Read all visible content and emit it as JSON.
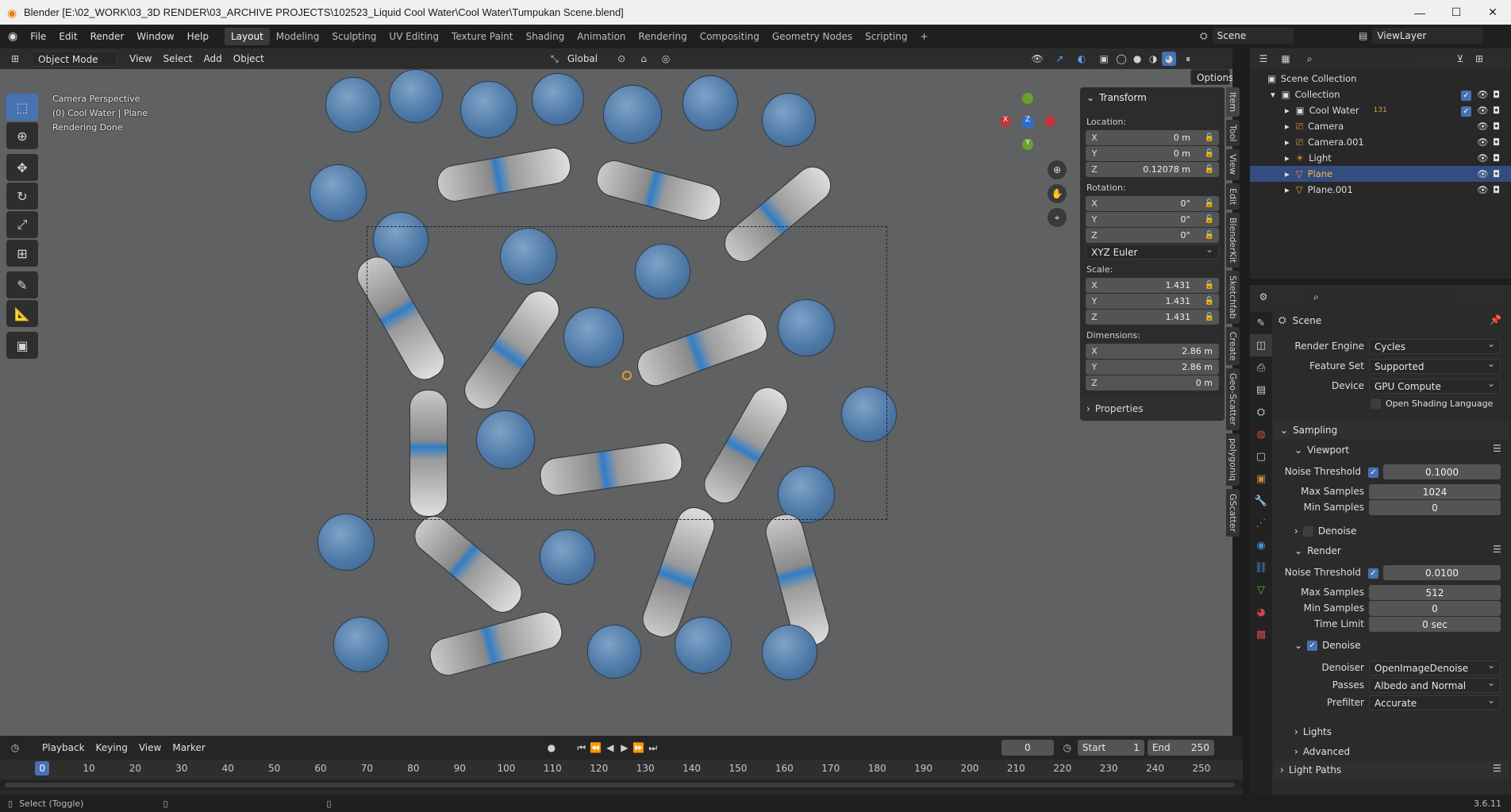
{
  "window": {
    "title": "Blender [E:\\02_WORK\\03_3D RENDER\\03_ARCHIVE PROJECTS\\102523_Liquid Cool Water\\Cool Water\\Tumpukan Scene.blend]"
  },
  "menu": [
    "File",
    "Edit",
    "Render",
    "Window",
    "Help"
  ],
  "workspaces": [
    "Layout",
    "Modeling",
    "Sculpting",
    "UV Editing",
    "Texture Paint",
    "Shading",
    "Animation",
    "Rendering",
    "Compositing",
    "Geometry Nodes",
    "Scripting"
  ],
  "active_workspace": "Layout",
  "scene_name": "Scene",
  "view_layer": "ViewLayer",
  "viewport_header": {
    "mode": "Object Mode",
    "items": [
      "View",
      "Select",
      "Add",
      "Object"
    ],
    "orientation": "Global",
    "options": "Options"
  },
  "viewport_overlay": {
    "line1": "Camera Perspective",
    "line2": "(0) Cool Water | Plane",
    "line3": "Rendering Done"
  },
  "npanel": {
    "header": "Transform",
    "location_label": "Location:",
    "location": [
      {
        "axis": "X",
        "value": "0 m"
      },
      {
        "axis": "Y",
        "value": "0 m"
      },
      {
        "axis": "Z",
        "value": "0.12078 m"
      }
    ],
    "rotation_label": "Rotation:",
    "rotation": [
      {
        "axis": "X",
        "value": "0°"
      },
      {
        "axis": "Y",
        "value": "0°"
      },
      {
        "axis": "Z",
        "value": "0°"
      }
    ],
    "rotation_mode": "XYZ Euler",
    "scale_label": "Scale:",
    "scale": [
      {
        "axis": "X",
        "value": "1.431"
      },
      {
        "axis": "Y",
        "value": "1.431"
      },
      {
        "axis": "Z",
        "value": "1.431"
      }
    ],
    "dimensions_label": "Dimensions:",
    "dimensions": [
      {
        "axis": "X",
        "value": "2.86 m"
      },
      {
        "axis": "Y",
        "value": "2.86 m"
      },
      {
        "axis": "Z",
        "value": "0 m"
      }
    ],
    "properties": "Properties"
  },
  "side_tabs": [
    "Item",
    "Tool",
    "View",
    "Edit",
    "BlenderKit",
    "Sketchfab",
    "Create",
    "Geo-Scatter",
    "polygoniq",
    "GScatter"
  ],
  "outliner": {
    "root": "Scene Collection",
    "collection": "Collection",
    "items": [
      "Cool Water",
      "Camera",
      "Camera.001",
      "Light",
      "Plane",
      "Plane.001"
    ],
    "badge": "131",
    "selected": "Plane"
  },
  "properties": {
    "context": "Scene",
    "render_engine_label": "Render Engine",
    "render_engine": "Cycles",
    "feature_set_label": "Feature Set",
    "feature_set": "Supported",
    "device_label": "Device",
    "device": "GPU Compute",
    "osl": "Open Shading Language",
    "sampling": "Sampling",
    "viewport": "Viewport",
    "vp_noise_label": "Noise Threshold",
    "vp_noise": "0.1000",
    "vp_max_label": "Max Samples",
    "vp_max": "1024",
    "vp_min_label": "Min Samples",
    "vp_min": "0",
    "vp_denoise": "Denoise",
    "render": "Render",
    "r_noise_label": "Noise Threshold",
    "r_noise": "0.0100",
    "r_max_label": "Max Samples",
    "r_max": "512",
    "r_min_label": "Min Samples",
    "r_min": "0",
    "time_label": "Time Limit",
    "time": "0 sec",
    "r_denoise": "Denoise",
    "denoiser_label": "Denoiser",
    "denoiser": "OpenImageDenoise",
    "passes_label": "Passes",
    "passes": "Albedo and Normal",
    "prefilter_label": "Prefilter",
    "prefilter": "Accurate",
    "lights": "Lights",
    "advanced": "Advanced",
    "light_paths": "Light Paths"
  },
  "timeline": {
    "menus": [
      "Playback",
      "Keying",
      "View",
      "Marker"
    ],
    "current_frame": "0",
    "start_label": "Start",
    "start": "1",
    "end_label": "End",
    "end": "250",
    "ticks": [
      "0",
      "10",
      "20",
      "30",
      "40",
      "50",
      "60",
      "70",
      "80",
      "90",
      "100",
      "110",
      "120",
      "130",
      "140",
      "150",
      "160",
      "170",
      "180",
      "190",
      "200",
      "210",
      "220",
      "230",
      "240",
      "250"
    ]
  },
  "status": {
    "left": "Select (Toggle)",
    "version": "3.6.11"
  }
}
